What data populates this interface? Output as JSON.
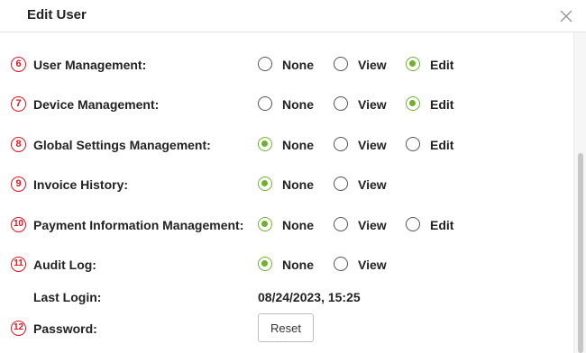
{
  "dialog": {
    "title": "Edit User",
    "close_icon": "close-icon"
  },
  "accent_color": "#6fb12e",
  "marker_color": "#e0161f",
  "option_labels": {
    "none": "None",
    "view": "View",
    "edit": "Edit"
  },
  "rows": [
    {
      "num": "6",
      "label": "User Management:",
      "options": [
        "None",
        "View",
        "Edit"
      ],
      "selected": "Edit"
    },
    {
      "num": "7",
      "label": "Device Management:",
      "options": [
        "None",
        "View",
        "Edit"
      ],
      "selected": "Edit"
    },
    {
      "num": "8",
      "label": "Global Settings Management:",
      "options": [
        "None",
        "View",
        "Edit"
      ],
      "selected": "None"
    },
    {
      "num": "9",
      "label": "Invoice History:",
      "options": [
        "None",
        "View"
      ],
      "selected": "None"
    },
    {
      "num": "10",
      "label": "Payment Information Management:",
      "options": [
        "None",
        "View",
        "Edit"
      ],
      "selected": "None"
    },
    {
      "num": "11",
      "label": "Audit Log:",
      "options": [
        "None",
        "View"
      ],
      "selected": "None"
    }
  ],
  "last_login": {
    "label": "Last Login:",
    "value": "08/24/2023, 15:25"
  },
  "password": {
    "num": "12",
    "label": "Password:",
    "button": "Reset"
  }
}
